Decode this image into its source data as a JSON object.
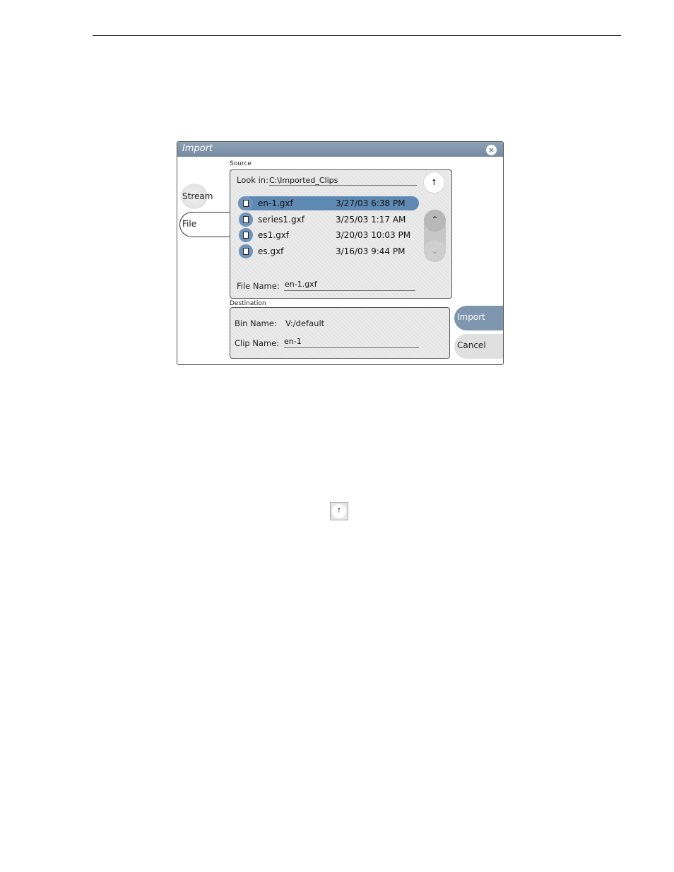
{
  "dialog": {
    "title": "Import",
    "close_icon": "×",
    "tabs": [
      {
        "label": "Stream"
      },
      {
        "label": "File"
      }
    ],
    "source": {
      "group_label": "Source",
      "look_in_label": "Look in:",
      "look_in_value": "C:\\Imported_Clips",
      "up_icon": "⭡",
      "files": [
        {
          "name": "en-1.gxf",
          "date": "3/27/03 6:38 PM",
          "selected": true
        },
        {
          "name": "series1.gxf",
          "date": "3/25/03 1:17 AM",
          "selected": false
        },
        {
          "name": "es1.gxf",
          "date": "3/20/03 10:03 PM",
          "selected": false
        },
        {
          "name": "es.gxf",
          "date": "3/16/03 9:44 PM",
          "selected": false
        }
      ],
      "scroll_up_icon": "⌃",
      "scroll_down_icon": "⌄",
      "file_name_label": "File Name:",
      "file_name_value": "en-1.gxf"
    },
    "destination": {
      "group_label": "Destination",
      "bin_name_label": "Bin Name:",
      "bin_name_value": "V:/default",
      "clip_name_label": "Clip Name:",
      "clip_name_value": "en-1"
    },
    "buttons": {
      "import": "Import",
      "cancel": "Cancel"
    }
  },
  "inline_icon": {
    "name": "up-folder-icon",
    "glyph": "⭡"
  }
}
